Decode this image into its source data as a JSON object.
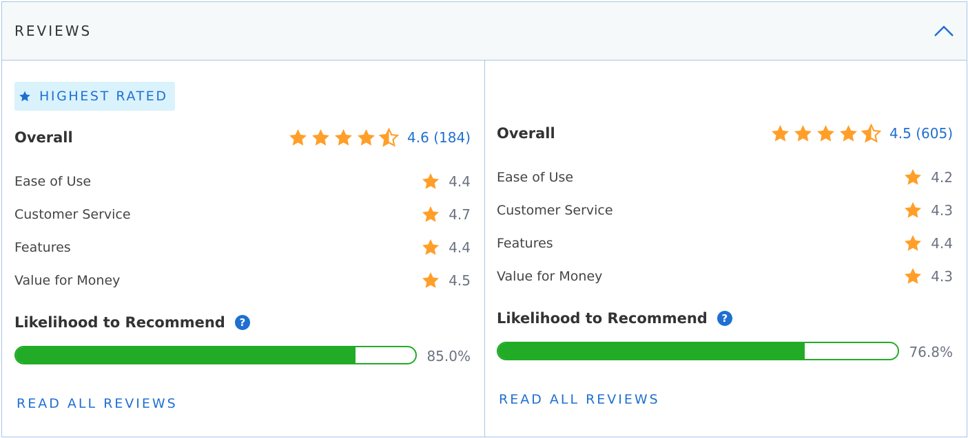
{
  "header": {
    "title": "REVIEWS",
    "collapse_icon": "chevron-up-icon"
  },
  "colors": {
    "accent": "#1f6fd1",
    "star": "#ff9f29",
    "bar": "#22ab26",
    "badge_bg": "#d9f2fb"
  },
  "columns": [
    {
      "badge": "HIGHEST RATED",
      "overall_label": "Overall",
      "overall_rating": 4.6,
      "overall_text": "4.6 (184)",
      "criteria": [
        {
          "label": "Ease of Use",
          "value": "4.4"
        },
        {
          "label": "Customer Service",
          "value": "4.7"
        },
        {
          "label": "Features",
          "value": "4.4"
        },
        {
          "label": "Value for Money",
          "value": "4.5"
        }
      ],
      "ltr_label": "Likelihood to Recommend",
      "ltr_percent": 85.0,
      "ltr_text": "85.0%",
      "read_all": "READ ALL REVIEWS"
    },
    {
      "overall_label": "Overall",
      "overall_rating": 4.5,
      "overall_text": "4.5 (605)",
      "criteria": [
        {
          "label": "Ease of Use",
          "value": "4.2"
        },
        {
          "label": "Customer Service",
          "value": "4.3"
        },
        {
          "label": "Features",
          "value": "4.4"
        },
        {
          "label": "Value for Money",
          "value": "4.3"
        }
      ],
      "ltr_label": "Likelihood to Recommend",
      "ltr_percent": 76.8,
      "ltr_text": "76.8%",
      "read_all": "READ ALL REVIEWS"
    }
  ]
}
